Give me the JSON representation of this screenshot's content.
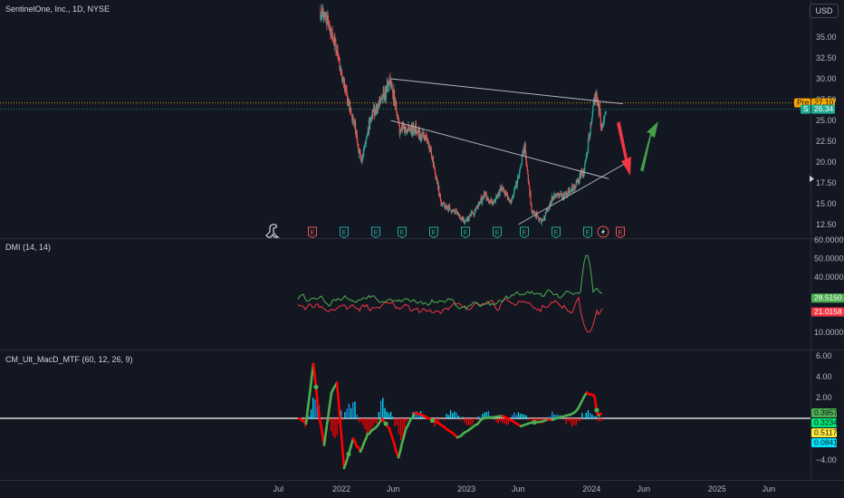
{
  "header": {
    "symbol_title": "SentinelOne, Inc., 1D, NYSE",
    "currency": "USD"
  },
  "colors": {
    "background": "#131722",
    "up": "#26a69a",
    "down": "#ef5350",
    "trendline": "#b2b5be",
    "pre_badge": "#f7a600",
    "last_badge": "#22ab94",
    "dmi_plus": "#4caf50",
    "dmi_minus": "#f23645",
    "macd_up": "#4caf50",
    "macd_down": "#ff0000",
    "hist_blue": "#2196f3",
    "hist_cyan": "#00e5ff",
    "arrow_red": "#f23645",
    "arrow_green": "#43a047"
  },
  "price_pane": {
    "ticks": [
      "35.00",
      "32.50",
      "30.00",
      "27.50",
      "25.00",
      "22.50",
      "20.00",
      "17.50",
      "15.00",
      "12.50"
    ],
    "pre_label": "Pre",
    "pre_value": "27.10",
    "last_label": "S",
    "last_value": "26.34",
    "event_markers": [
      "E",
      "E",
      "E",
      "E",
      "E",
      "E",
      "E",
      "E",
      "E",
      "E",
      "E"
    ]
  },
  "dmi_pane": {
    "title": "DMI (14, 14)",
    "ticks": [
      "60.0000",
      "50.0000",
      "40.0000",
      "10.0000"
    ],
    "plus_value": "28.5150",
    "minus_value": "21.0158"
  },
  "macd_pane": {
    "title": "CM_Ult_MacD_MTF (60, 12, 26, 9)",
    "ticks": [
      "6.00",
      "4.00",
      "2.00",
      "−4.00"
    ],
    "values": [
      "0.3957",
      "0.3234",
      "0.5117",
      "0.0841"
    ],
    "value_colors": [
      "#4caf50",
      "#00e676",
      "#ffeb3b",
      "#00e5ff"
    ]
  },
  "time_axis": {
    "labels": [
      "Jul",
      "2022",
      "Jun",
      "2023",
      "Jun",
      "2024",
      "Jun",
      "2025",
      "Jun"
    ]
  },
  "chart_data": {
    "type": "candlestick",
    "title": "SentinelOne, Inc., 1D, NYSE",
    "ylim": [
      11,
      37.5
    ],
    "x_domain": [
      "2021-06-30",
      "2025-08-01"
    ],
    "price_path": [
      [
        "2021-07-01",
        40
      ],
      [
        "2021-11-10",
        38
      ],
      [
        "2021-12-15",
        34
      ],
      [
        "2022-01-05",
        30
      ],
      [
        "2022-02-10",
        24
      ],
      [
        "2022-03-01",
        20
      ],
      [
        "2022-04-01",
        26
      ],
      [
        "2022-05-05",
        28
      ],
      [
        "2022-05-25",
        30
      ],
      [
        "2022-06-20",
        24
      ],
      [
        "2022-08-01",
        24
      ],
      [
        "2022-09-15",
        22
      ],
      [
        "2022-10-20",
        15
      ],
      [
        "2022-12-01",
        14
      ],
      [
        "2022-12-25",
        13
      ],
      [
        "2023-01-25",
        14
      ],
      [
        "2023-02-20",
        16
      ],
      [
        "2023-03-20",
        15
      ],
      [
        "2023-04-15",
        17
      ],
      [
        "2023-05-10",
        15
      ],
      [
        "2023-06-01",
        18
      ],
      [
        "2023-06-20",
        22
      ],
      [
        "2023-07-10",
        14
      ],
      [
        "2023-08-10",
        13
      ],
      [
        "2023-09-15",
        16
      ],
      [
        "2023-10-15",
        16
      ],
      [
        "2023-11-10",
        17
      ],
      [
        "2023-12-10",
        19
      ],
      [
        "2023-12-25",
        23
      ],
      [
        "2024-01-10",
        28
      ],
      [
        "2024-01-22",
        27
      ],
      [
        "2024-01-30",
        24
      ],
      [
        "2024-02-12",
        26.3
      ]
    ],
    "trendlines": [
      {
        "from": [
          "2022-05-25",
          30.0
        ],
        "to": [
          "2024-04-01",
          27.0
        ]
      },
      {
        "from": [
          "2022-05-25",
          25.0
        ],
        "to": [
          "2024-02-20",
          18.0
        ]
      },
      {
        "from": [
          "2023-06-01",
          12.5
        ],
        "to": [
          "2024-04-15",
          20.0
        ]
      }
    ],
    "annotations": [
      {
        "type": "arrow",
        "color": "red",
        "direction": "down"
      },
      {
        "type": "arrow",
        "color": "green",
        "direction": "up"
      }
    ],
    "pre_market_price": 27.1,
    "last_price": 26.34,
    "dmi": {
      "period": [
        14,
        14
      ],
      "plus_di": 28.515,
      "minus_di": 21.0158,
      "ylim": [
        0,
        60
      ]
    },
    "macd": {
      "params": [
        60,
        12,
        26,
        9
      ],
      "values": [
        0.3957,
        0.3234,
        0.5117,
        0.0841
      ],
      "ylim": [
        -4.5,
        6.5
      ]
    }
  }
}
